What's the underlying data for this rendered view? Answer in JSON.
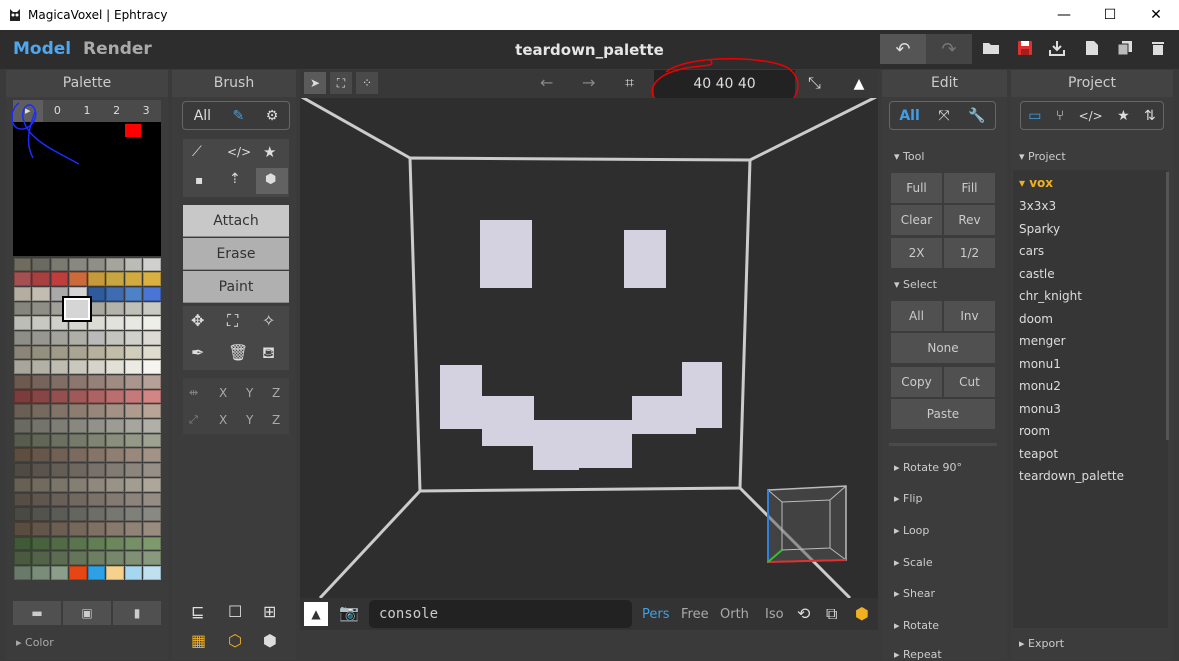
{
  "window": {
    "title": "MagicaVoxel | Ephtracy",
    "icon": "owl-app-icon",
    "minimize": "—",
    "maximize": "☐",
    "close": "✕"
  },
  "header": {
    "model_tab": "Model",
    "render_tab": "Render",
    "filename": "teardown_palette"
  },
  "palette": {
    "title": "Palette",
    "tabs": [
      "▸",
      "0",
      "1",
      "2",
      "3"
    ],
    "color_section": "▸ Color",
    "colors": [
      "#6f6b5e",
      "#6b6a60",
      "#7a7a70",
      "#888880",
      "#8f8f88",
      "#a5a59e",
      "#bcbcb6",
      "#d0d0cc",
      "#a55050",
      "#a84040",
      "#c03d3d",
      "#cc6a3b",
      "#c49a3a",
      "#c7a540",
      "#d1aa40",
      "#d9b140",
      "#b5aea0",
      "#c2bdb0",
      "#a9a9a9",
      "#d5d5d5",
      "#2f5a9c",
      "#3f6cb1",
      "#4e82c8",
      "#4a74d6",
      "#85857e",
      "#8e8e86",
      "#a0a098",
      "#96968f",
      "#a8a8a1",
      "#b3b3ac",
      "#c0c0ba",
      "#cacac4",
      "#bdbdb7",
      "#c8c8c2",
      "#d0d0ca",
      "#d6d6d0",
      "#dcdcd6",
      "#e2e2dc",
      "#e8e8e2",
      "#efefe9",
      "#8e8e86",
      "#979790",
      "#a3a39c",
      "#afafa8",
      "#bababa",
      "#c5c5bf",
      "#d1d1cb",
      "#dddad5",
      "#8a8578",
      "#94907f",
      "#a09b89",
      "#aaa592",
      "#b6b19d",
      "#c2bda8",
      "#d1cdbb",
      "#e0ddcf",
      "#a8a59a",
      "#b3b0a5",
      "#bfbcb1",
      "#cac8bd",
      "#d6d4ca",
      "#e1dfd6",
      "#eceae2",
      "#f5f4ef",
      "#6c5a4e",
      "#76635a",
      "#806d64",
      "#8b776e",
      "#958178",
      "#a08b82",
      "#ab968d",
      "#b6a198",
      "#7a3c3c",
      "#874545",
      "#944f4f",
      "#a05959",
      "#ad6363",
      "#ba6e6e",
      "#c67979",
      "#d38484",
      "#6b5f55",
      "#76695e",
      "#817367",
      "#8c7d70",
      "#97877a",
      "#a29184",
      "#ad9b8e",
      "#b8a598",
      "#6a6a62",
      "#74746c",
      "#7e7e76",
      "#888880",
      "#92928a",
      "#9c9c94",
      "#a6a69e",
      "#b0b0a8",
      "#575c4e",
      "#616657",
      "#6b7060",
      "#757a6a",
      "#7f8473",
      "#898e7d",
      "#939887",
      "#9da291",
      "#5d4e40",
      "#67574a",
      "#716154",
      "#7b6b5e",
      "#857568",
      "#8f7f72",
      "#99897c",
      "#a39386",
      "#4f4a43",
      "#59534c",
      "#635d56",
      "#6d6760",
      "#77716a",
      "#817b74",
      "#8b857e",
      "#958f88",
      "#666055",
      "#706a5f",
      "#7a7469",
      "#847e73",
      "#8e887d",
      "#989287",
      "#a29c91",
      "#aca69b",
      "#564e44",
      "#5f574d",
      "#686056",
      "#71695f",
      "#7a7268",
      "#837b71",
      "#8c847a",
      "#958d83",
      "#4a4a44",
      "#53534d",
      "#5c5c56",
      "#65655f",
      "#6e6e68",
      "#777771",
      "#80807a",
      "#898983",
      "#5a4c3e",
      "#635547",
      "#6c5e50",
      "#756759",
      "#7e7062",
      "#87796b",
      "#908274",
      "#998b7d",
      "#3f5a34",
      "#48633c",
      "#516c44",
      "#5a754c",
      "#637e54",
      "#6c875c",
      "#759064",
      "#7e996c",
      "#4a5a3e",
      "#536347",
      "#5c6c50",
      "#657559",
      "#6e7e62",
      "#77876b",
      "#809074",
      "#89997d",
      "#6a7a6a",
      "#7a8c7a",
      "#8a9e8a",
      "#e64614",
      "#2ea0e6",
      "#f5d18c",
      "#a5d8f0",
      "#c0e0f0"
    ]
  },
  "brush": {
    "title": "Brush",
    "filter_all": "All",
    "attach": "Attach",
    "erase": "Erase",
    "paint": "Paint",
    "axis_labels": [
      "X",
      "Y",
      "Z",
      "X",
      "Y",
      "Z"
    ]
  },
  "viewport": {
    "dimension_readout": "40  40  40",
    "console_placeholder": "console",
    "cam_modes": [
      "Pers",
      "Free",
      "Orth",
      "Iso"
    ]
  },
  "edit": {
    "title": "Edit",
    "filter_all": "All",
    "tool_section": "▾ Tool",
    "select_section": "▾ Select",
    "tool_buttons": [
      "Full",
      "Fill",
      "Clear",
      "Rev",
      "2X",
      "1/2"
    ],
    "select_buttons": [
      "All",
      "Inv",
      "None",
      "Copy",
      "Cut",
      "Paste"
    ],
    "sections": [
      "▸ Rotate 90°",
      "▸ Flip",
      "▸ Loop",
      "▸ Scale",
      "▸ Shear",
      "▸ Rotate",
      "▸ Repeat"
    ]
  },
  "project": {
    "title": "Project",
    "section": "▾ Project",
    "folder": "▾ vox",
    "export": "▸ Export",
    "items": [
      "3x3x3",
      "Sparky",
      "cars",
      "castle",
      "chr_knight",
      "doom",
      "menger",
      "monu1",
      "monu2",
      "monu3",
      "room",
      "teapot",
      "teardown_palette"
    ]
  }
}
